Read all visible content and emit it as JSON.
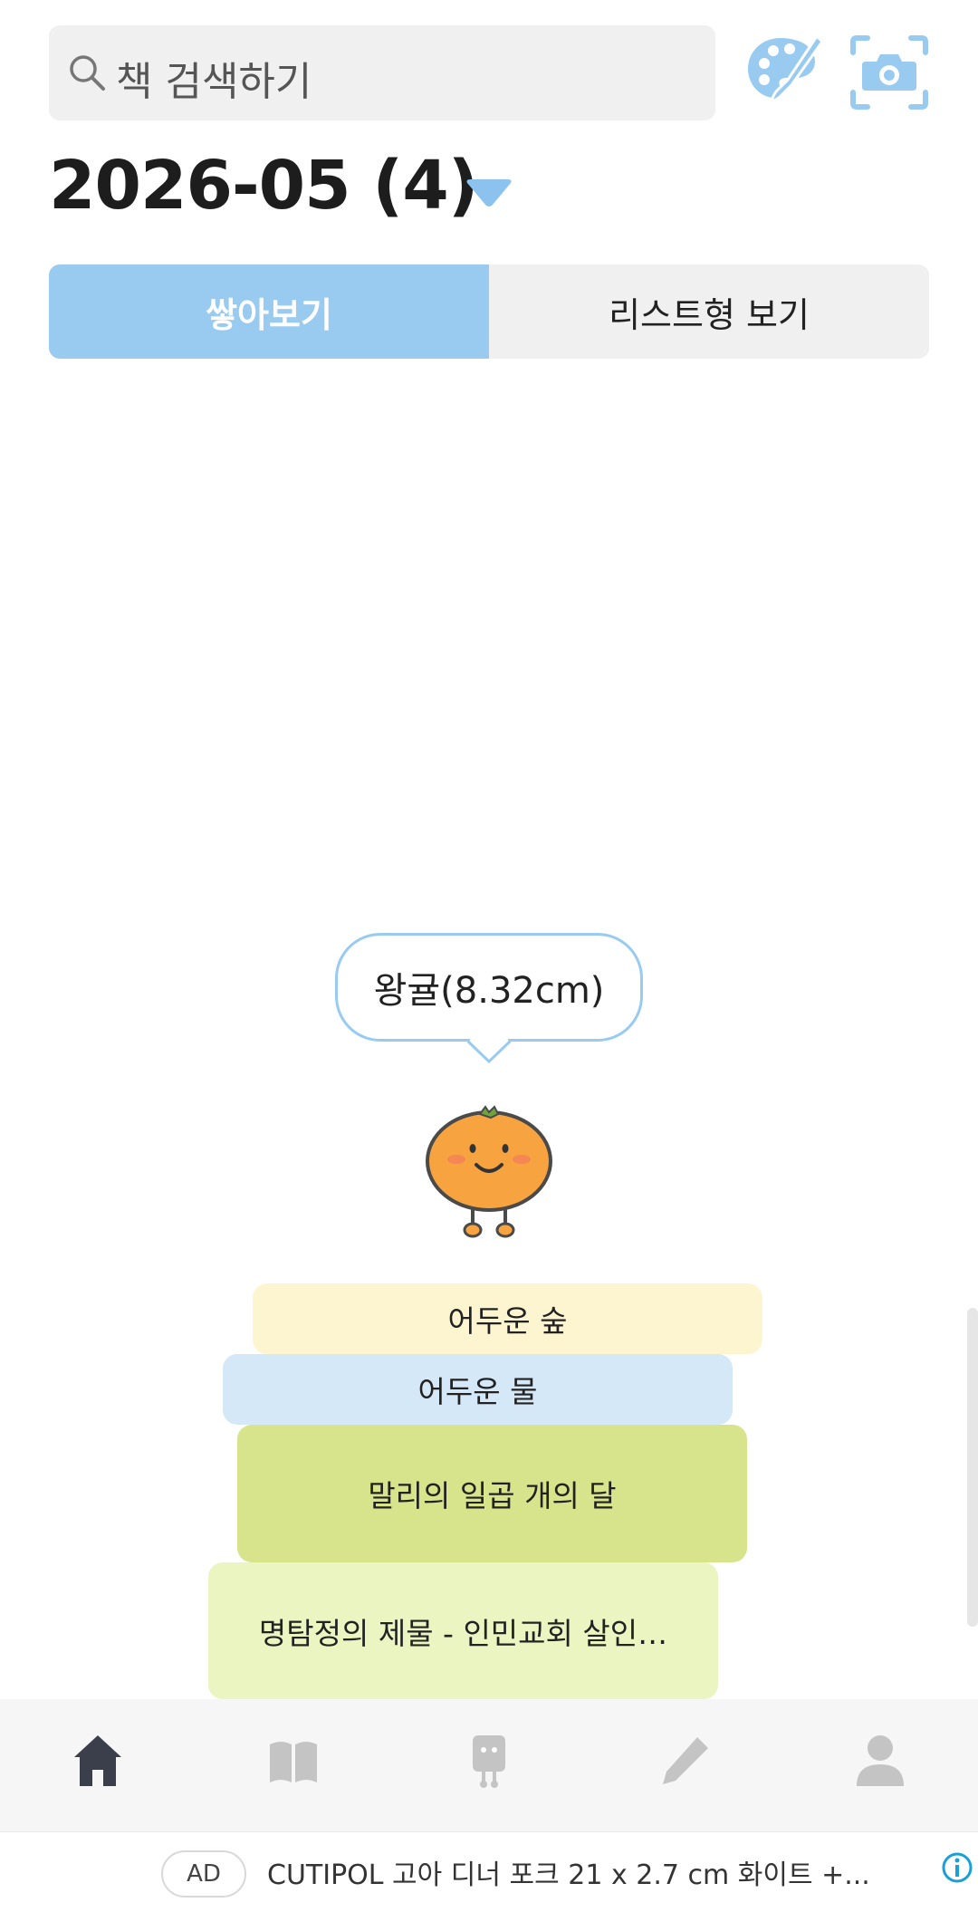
{
  "search": {
    "placeholder": "책 검색하기"
  },
  "header": {
    "month_label": "2026-05 (4)"
  },
  "view_toggle": {
    "stack_label": "쌓아보기",
    "list_label": "리스트형 보기",
    "selected": "stack"
  },
  "bubble": {
    "text": "왕귤(8.32cm)"
  },
  "books": [
    {
      "title": "어두운 숲",
      "color": "#fdf5d0"
    },
    {
      "title": "어두운 물",
      "color": "#d5e8f7"
    },
    {
      "title": "말리의 일곱 개의 달",
      "color": "#d8e48c"
    },
    {
      "title": "명탐정의 제물 - 인민교회 살인…",
      "color": "#eaf5c2"
    }
  ],
  "nav": [
    {
      "name": "home",
      "icon": "home-icon",
      "active": true
    },
    {
      "name": "books",
      "icon": "open-book-icon",
      "active": false
    },
    {
      "name": "bookmark",
      "icon": "character-icon",
      "active": false
    },
    {
      "name": "write",
      "icon": "pencil-icon",
      "active": false
    },
    {
      "name": "profile",
      "icon": "person-icon",
      "active": false
    }
  ],
  "ad": {
    "badge": "AD",
    "text": "CUTIPOL 고아 디너 포크 21 x 2.7 cm 화이트 +..."
  },
  "colors": {
    "accent": "#99cbf1",
    "nav_active": "#3a3f4b",
    "nav_inactive": "#c4c4c4"
  }
}
